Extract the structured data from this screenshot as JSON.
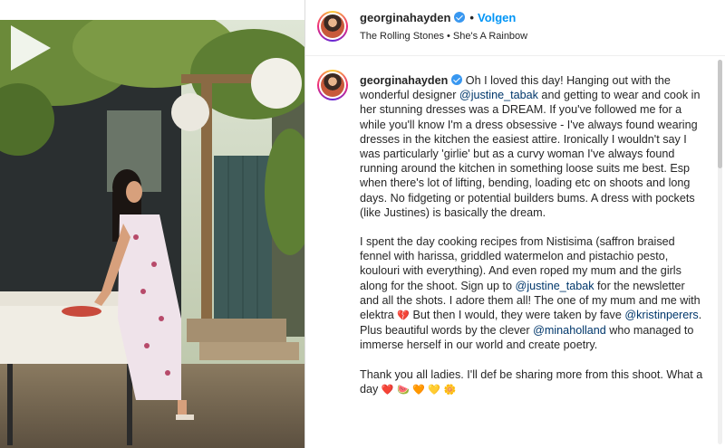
{
  "header": {
    "username": "georginahayden",
    "separator": "•",
    "follow_label": "Volgen",
    "audio": "The Rolling Stones • She's A Rainbow"
  },
  "caption": {
    "username": "georginahayden",
    "p1_a": "Oh I loved this day! Hanging out with the wonderful designer ",
    "mention1": "@justine_tabak",
    "p1_b": " and getting to wear and cook in her stunning dresses was a DREAM. If you've followed me for a while you'll know I'm a dress obsessive - I've always found wearing dresses in the kitchen the easiest attire. Ironically I wouldn't say I was particularly 'girlie' but as a curvy woman I've always found running around the kitchen in something loose suits me best. Esp when there's lot of lifting, bending, loading etc on shoots and long days. No fidgeting or potential builders bums. A dress with pockets (like Justines) is basically the dream.",
    "p2_a": "I spent the day cooking recipes from Nistisima (saffron braised fennel with harissa, griddled watermelon and pistachio pesto, koulouri with everything). And even roped my mum and the girls along for the shoot. Sign up to ",
    "mention2": "@justine_tabak",
    "p2_b": " for the newsletter and all the shots. I adore them all! The one of my mum and me with elektra ",
    "emoji_broken_heart": "💔",
    "p2_c": " But then I would, they were taken by fave ",
    "mention3": "@kristinperers",
    "p2_d": ". Plus beautiful words by the clever ",
    "mention4": "@minaholland",
    "p2_e": " who managed to immerse herself in our world and create poetry.",
    "p3_a": "Thank you all ladies. I'll def be sharing more from this shoot. What a day ",
    "p3_emojis": "❤️ 🍉 🧡 💛 🌼"
  },
  "icons": {
    "play": "play-icon",
    "verified": "verified-badge-icon"
  },
  "colors": {
    "link": "#00376b",
    "follow": "#0095f6",
    "verified": "#3897f0"
  }
}
